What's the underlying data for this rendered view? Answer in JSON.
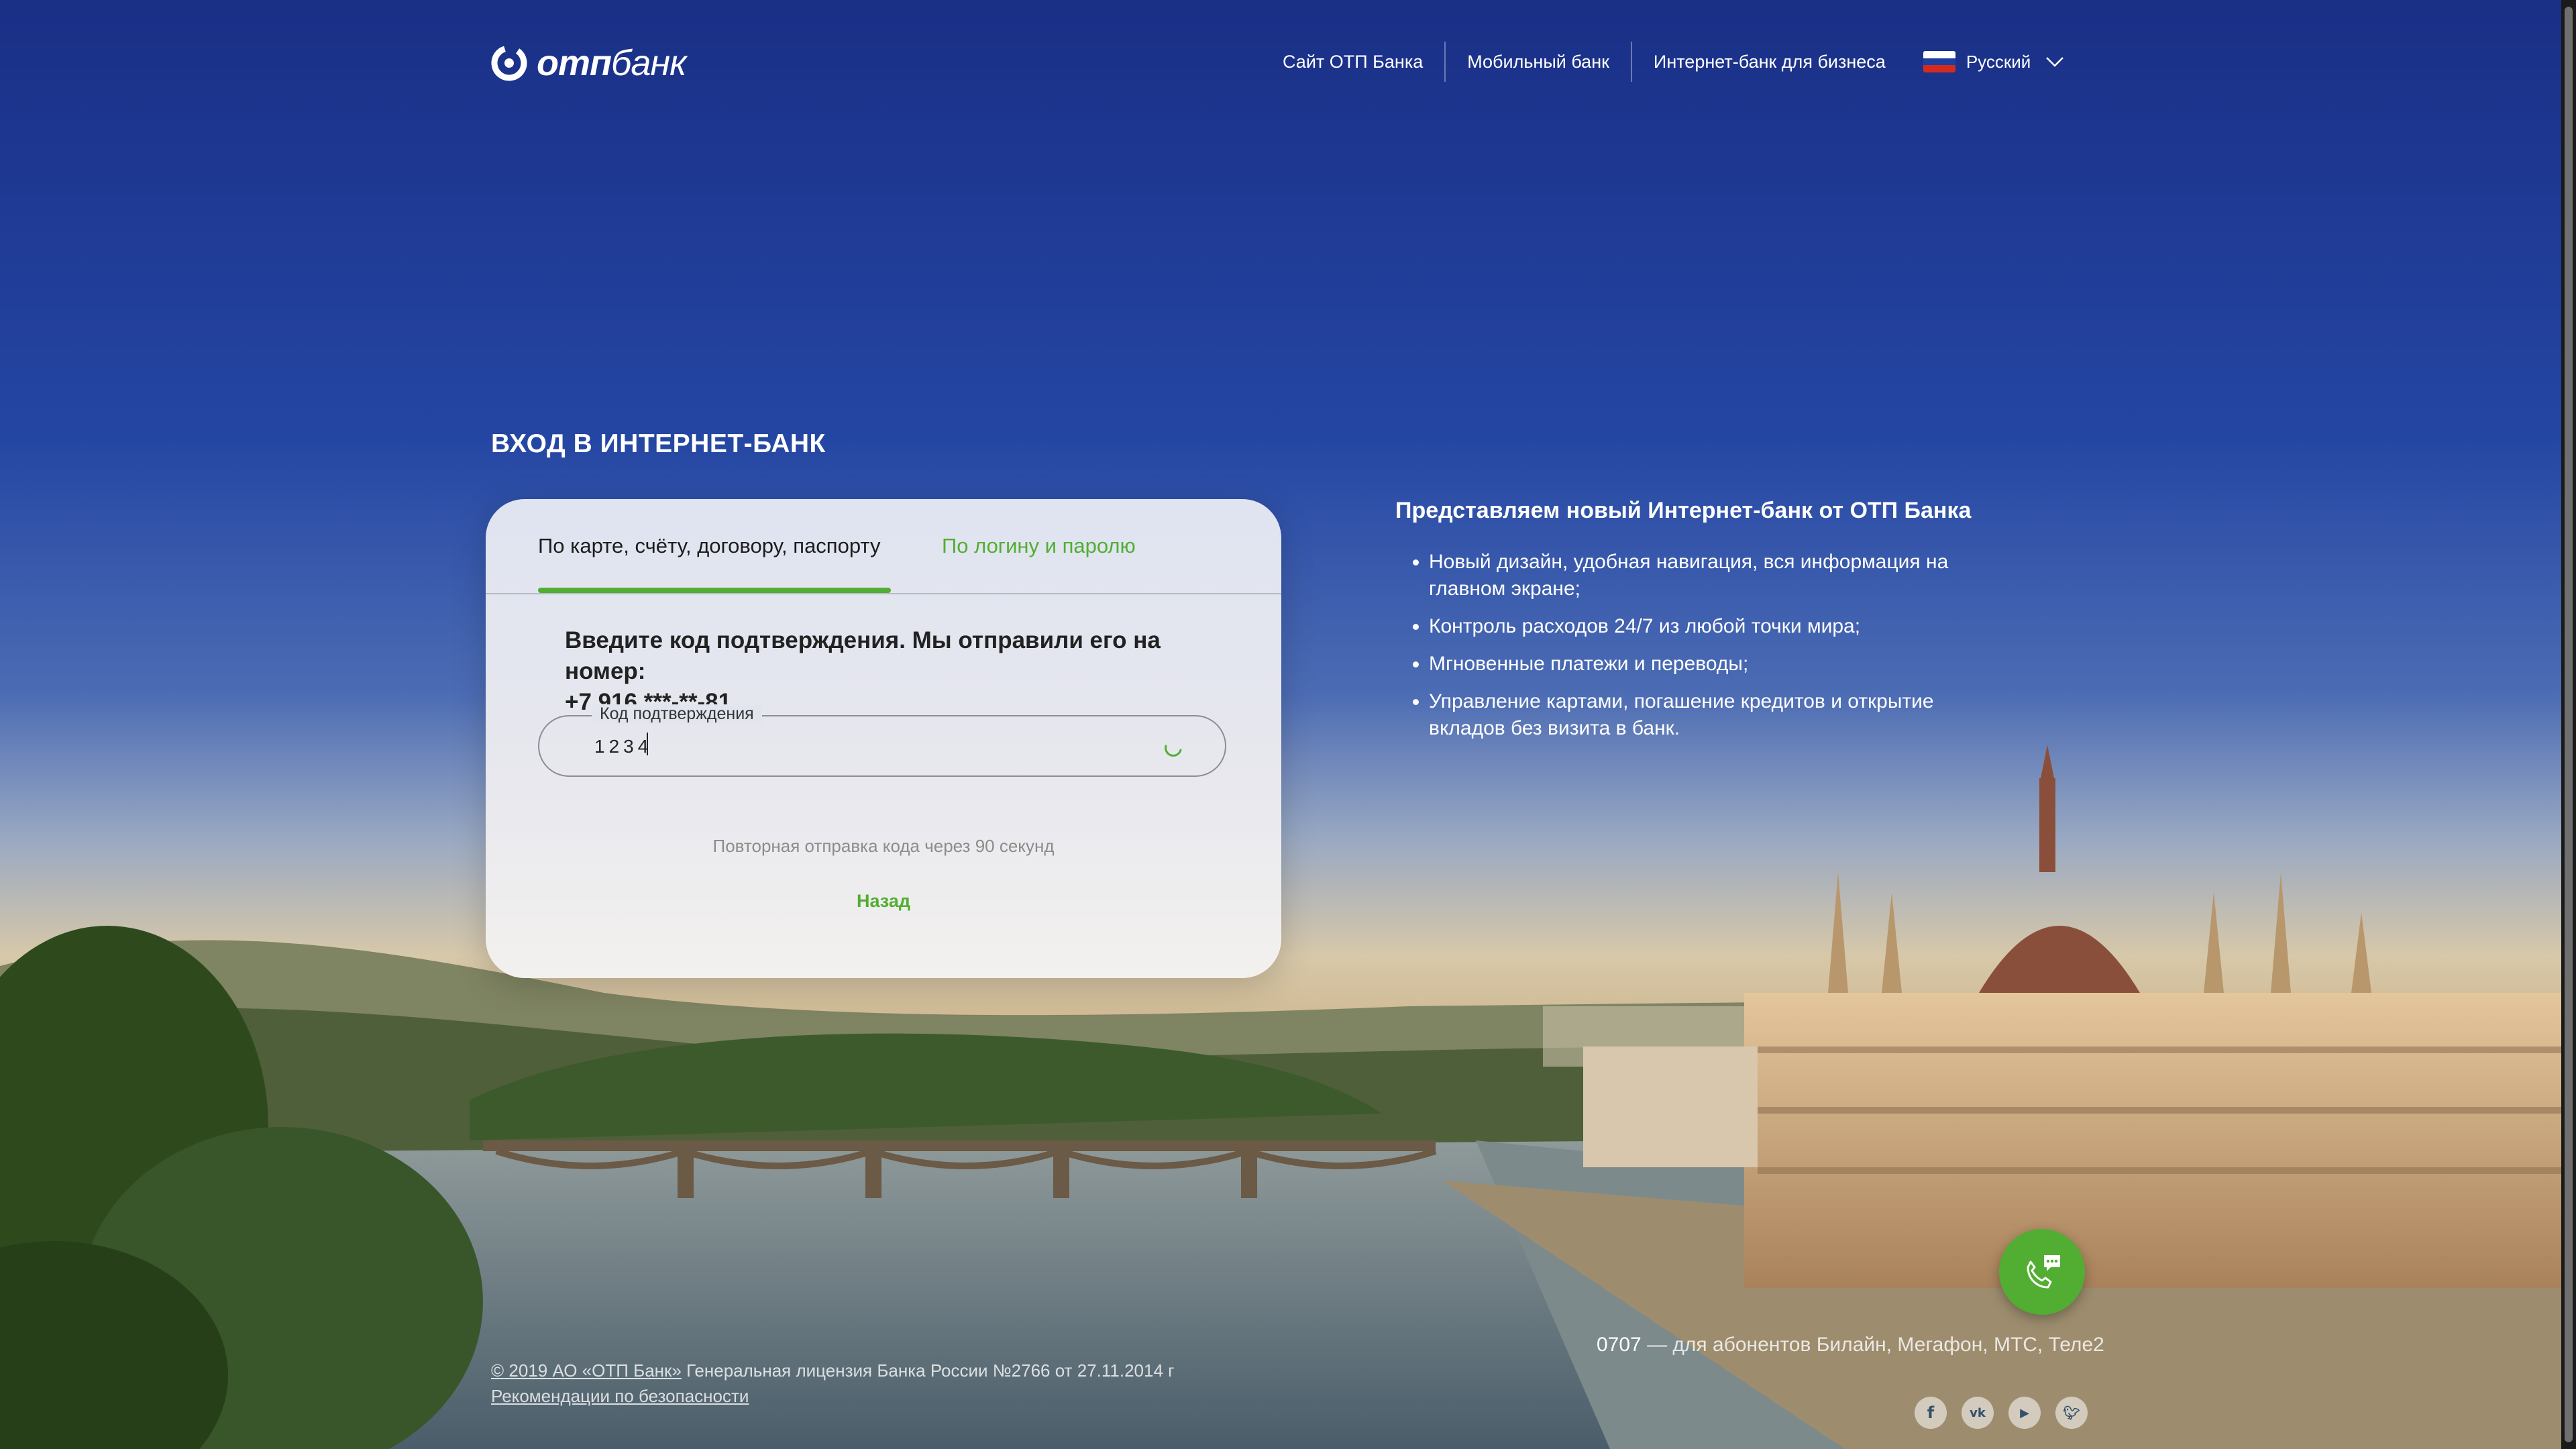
{
  "header": {
    "logo_text_bold": "отп",
    "logo_text_light": "банк",
    "nav": [
      "Сайт ОТП Банка",
      "Мобильный банк",
      "Интернет-банк для бизнеса"
    ],
    "language": "Русский"
  },
  "login": {
    "title": "ВХОД В ИНТЕРНЕТ-БАНК",
    "tabs": [
      {
        "label": "По карте, счёту, договору, паспорту",
        "active": true
      },
      {
        "label": "По логину и паролю",
        "active": false
      }
    ],
    "prompt": "Введите код подтверждения. Мы отправили его на номер:",
    "phone": "+7 916 ***-**-81",
    "code_field": {
      "label": "Код подтверждения",
      "value": "1234"
    },
    "resend_text": "Повторная отправка кода через 90 секунд",
    "back_label": "Назад"
  },
  "promo": {
    "title": "Представляем новый Интернет-банк от ОТП Банка",
    "items": [
      "Новый дизайн, удобная навигация, вся информация на главном экране;",
      "Контроль расходов 24/7 из любой точки мира;",
      "Мгновенные платежи и переводы;",
      "Управление картами, погашение кредитов и открытие вкладов без визита в банк."
    ]
  },
  "footer": {
    "copyright_link": "© 2019 АО «ОТП Банк»",
    "license": " Генеральная лицензия Банка России №2766 от 27.11.2014 г",
    "security_link": "Рекомендации по безопасности",
    "hotline_number": "0707",
    "hotline_text": " — для абонентов Билайн, Мегафон, МТС, Теле2",
    "socials": [
      "facebook-icon",
      "vk-icon",
      "youtube-icon",
      "twitter-icon"
    ]
  },
  "colors": {
    "accent": "#52ae32",
    "sky_top": "#1d3a8f",
    "card_bg": "#e4e7ef"
  }
}
